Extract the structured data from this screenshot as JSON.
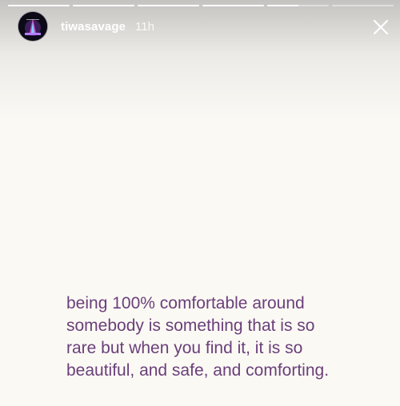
{
  "story": {
    "username": "tiwasavage",
    "timestamp": "11h",
    "close_icon": "close-icon",
    "avatar_icon": "avatar-image",
    "progress": [
      1,
      1,
      1,
      1,
      0.5,
      0
    ],
    "quote_lines": [
      "being 100% comfortable around",
      "somebody is something that is so",
      "rare but when you find it, it is so",
      "beautiful, and safe, and comforting."
    ]
  },
  "colors": {
    "background": "#fbf9f4",
    "quote_text": "#6a3f7a",
    "header_text": "#ffffff"
  }
}
